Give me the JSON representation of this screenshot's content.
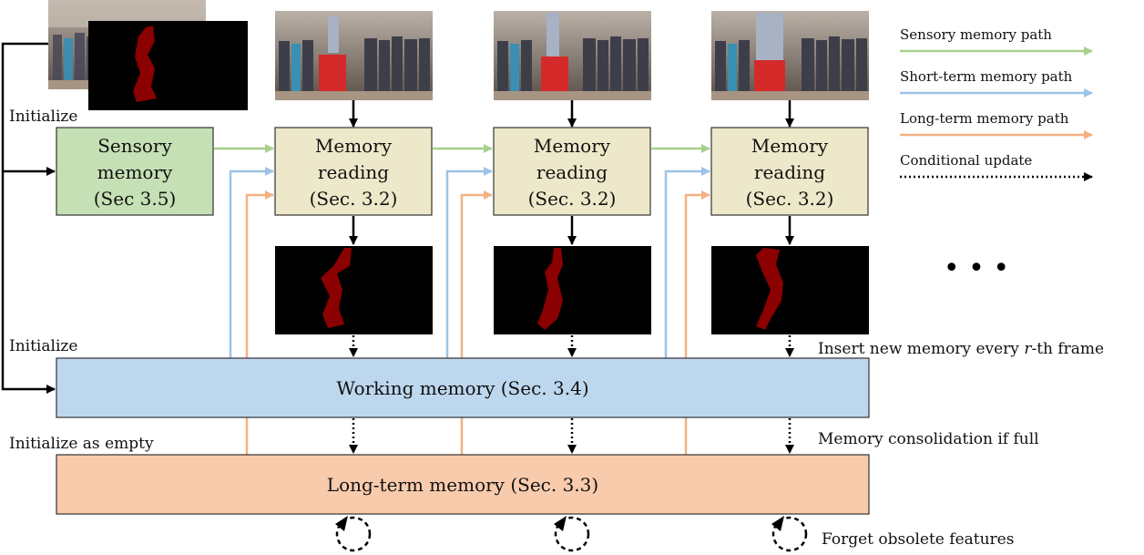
{
  "colors": {
    "sensory": "#a8d08d",
    "short_term": "#9dc3e6",
    "long_term": "#f4b183",
    "sensory_box_fill": "#c5e0b4",
    "reading_box_fill": "#ede8c9",
    "working_box_fill": "#bdd7ee",
    "longterm_box_fill": "#f8cbad",
    "mask_color": "#8b0000"
  },
  "boxes": {
    "sensory": {
      "lines": [
        "Sensory",
        "memory",
        "(Sec 3.5)"
      ]
    },
    "reading": {
      "lines": [
        "Memory",
        "reading",
        "(Sec. 3.2)"
      ]
    },
    "working": {
      "label": "Working memory (Sec. 3.4)"
    },
    "longterm": {
      "label": "Long-term memory (Sec. 3.3)"
    }
  },
  "labels": {
    "init_sensory": "Initialize",
    "init_working": "Initialize",
    "init_longterm": "Initialize as empty",
    "insert_memory_prefix": "Insert new memory every ",
    "insert_memory_var": "r",
    "insert_memory_suffix": "-th frame",
    "consolidation": "Memory consolidation if full",
    "forget": "Forget obsolete features",
    "ellipsis": "• • •"
  },
  "legend": [
    {
      "label": "Sensory memory path",
      "style": "green-solid"
    },
    {
      "label": "Short-term memory path",
      "style": "blue-solid"
    },
    {
      "label": "Long-term memory path",
      "style": "orange-solid"
    },
    {
      "label": "Conditional update",
      "style": "black-dotted"
    }
  ],
  "frames": [
    {
      "name": "frame-1"
    },
    {
      "name": "frame-2"
    },
    {
      "name": "frame-3"
    }
  ]
}
